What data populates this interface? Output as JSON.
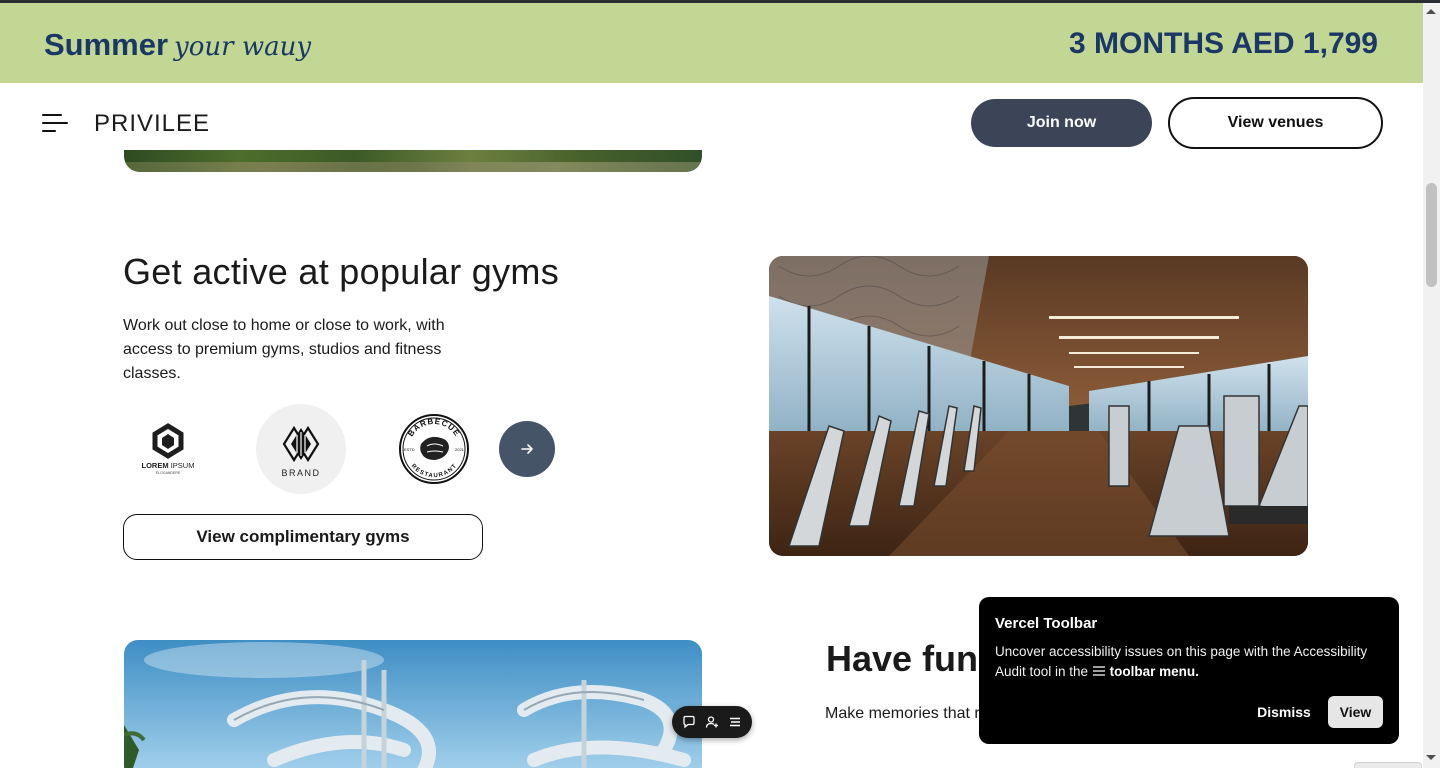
{
  "promo": {
    "brand_bold": "Summer",
    "brand_script": "your wauy",
    "offer": "3 MONTHS AED 1,799"
  },
  "nav": {
    "logo": "PRIVILEE",
    "join_label": "Join now",
    "venues_label": "View venues"
  },
  "gyms": {
    "title": "Get active at popular gyms",
    "description": "Work out close to home or close to work, with access to premium gyms, studios and fitness classes.",
    "logos": [
      {
        "main": "LOREM",
        "main2": "IPSUM",
        "sub": "ELOGANDERE"
      },
      {
        "main": "BRAND"
      },
      {
        "top": "BARBECUE",
        "bottom": "RESTAURANT",
        "left": "ESTD",
        "right": "2021"
      }
    ],
    "cta": "View complimentary gyms"
  },
  "fun": {
    "title": "Have fun",
    "description": "Make memories that resorts, splash pads"
  },
  "toast": {
    "title": "Vercel Toolbar",
    "body_prefix": "Uncover accessibility issues on this page with the Accessibility Audit tool in the",
    "body_bold": "toolbar menu.",
    "dismiss": "Dismiss",
    "view": "View"
  },
  "colors": {
    "promo_bg": "#c2d794",
    "promo_text": "#1a3766",
    "join_bg": "#3c4557",
    "next_bg": "#465468",
    "toast_bg": "#000000"
  },
  "icons": {
    "menu": "hamburger-menu-icon",
    "next": "arrow-right-icon",
    "toolbar": [
      "comment-icon",
      "add-user-icon",
      "toolbar-menu-icon"
    ]
  }
}
